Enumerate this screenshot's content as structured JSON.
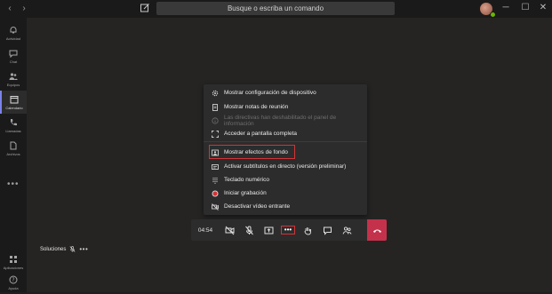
{
  "titlebar": {
    "search_placeholder": "Busque o escriba un comando",
    "nav_back": "‹",
    "nav_forward": "›",
    "minimize": "─",
    "maximize": "☐",
    "close": "✕"
  },
  "rail": {
    "items": [
      {
        "label": "Actividad",
        "icon": "bell-icon"
      },
      {
        "label": "Chat",
        "icon": "chat-icon"
      },
      {
        "label": "Equipos",
        "icon": "teams-icon"
      },
      {
        "label": "Calendario",
        "icon": "calendar-icon",
        "active": true
      },
      {
        "label": "Llamadas",
        "icon": "phone-icon"
      },
      {
        "label": "Archivos",
        "icon": "files-icon"
      }
    ],
    "more": "•••",
    "bottom": [
      {
        "label": "Aplicaciones",
        "icon": "apps-icon"
      },
      {
        "label": "Ayuda",
        "icon": "help-icon"
      }
    ]
  },
  "menu": {
    "items": [
      {
        "label": "Mostrar configuración de dispositivo",
        "icon": "gear-icon"
      },
      {
        "label": "Mostrar notas de reunión",
        "icon": "notes-icon"
      },
      {
        "label": "Las directivas han deshabilitado el panel de información",
        "icon": "info-icon",
        "disabled": true
      },
      {
        "label": "Acceder a pantalla completa",
        "icon": "fullscreen-icon"
      },
      {
        "label": "Mostrar efectos de fondo",
        "icon": "background-effects-icon",
        "highlighted": true
      },
      {
        "label": "Activar subtítulos en directo (versión preliminar)",
        "icon": "captions-icon"
      },
      {
        "label": "Teclado numérico",
        "icon": "keypad-icon"
      },
      {
        "label": "Iniciar grabación",
        "icon": "record-icon"
      },
      {
        "label": "Desactivar vídeo entrante",
        "icon": "video-off-icon"
      }
    ]
  },
  "callbar": {
    "timer": "04:54",
    "more": "•••"
  },
  "participant": {
    "name": "Soluciones",
    "more": "•••"
  },
  "colors": {
    "accent": "#7b83eb",
    "highlight": "#d13438",
    "hangup": "#c4314b",
    "presence": "#6bb700"
  }
}
